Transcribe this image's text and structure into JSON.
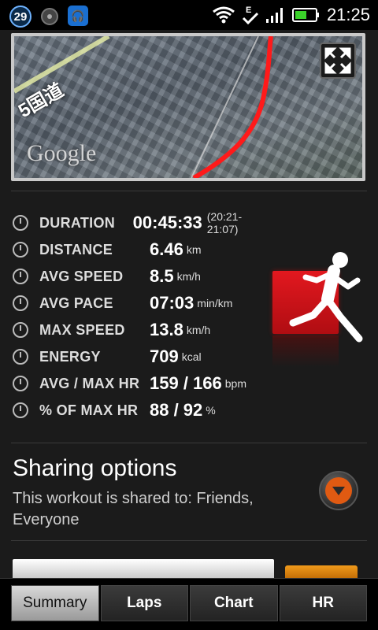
{
  "status_bar": {
    "badge_count": "29",
    "time": "21:25"
  },
  "map": {
    "google_label": "Google",
    "road_label": "5国道"
  },
  "stats": [
    {
      "label": "DURATION",
      "value": "00:45:33",
      "unit": "",
      "extra": "(20:21-21:07)"
    },
    {
      "label": "DISTANCE",
      "value": "6.46",
      "unit": "km",
      "extra": ""
    },
    {
      "label": "AVG SPEED",
      "value": "8.5",
      "unit": "km/h",
      "extra": ""
    },
    {
      "label": "AVG PACE",
      "value": "07:03",
      "unit": "min/km",
      "extra": ""
    },
    {
      "label": "MAX SPEED",
      "value": "13.8",
      "unit": "km/h",
      "extra": ""
    },
    {
      "label": "ENERGY",
      "value": "709",
      "unit": "kcal",
      "extra": ""
    },
    {
      "label": "AVG / MAX HR",
      "value": "159 / 166",
      "unit": "bpm",
      "extra": ""
    },
    {
      "label": "% OF MAX HR",
      "value": "88 / 92",
      "unit": "%",
      "extra": ""
    }
  ],
  "sharing": {
    "title": "Sharing options",
    "description": "This workout is shared to: Friends, Everyone"
  },
  "tabs": [
    {
      "label": "Summary",
      "active": true
    },
    {
      "label": "Laps",
      "active": false
    },
    {
      "label": "Chart",
      "active": false
    },
    {
      "label": "HR",
      "active": false
    }
  ],
  "colors": {
    "accent_red": "#e2181f",
    "route_red": "#ff1a1a",
    "orange": "#e05a12"
  }
}
